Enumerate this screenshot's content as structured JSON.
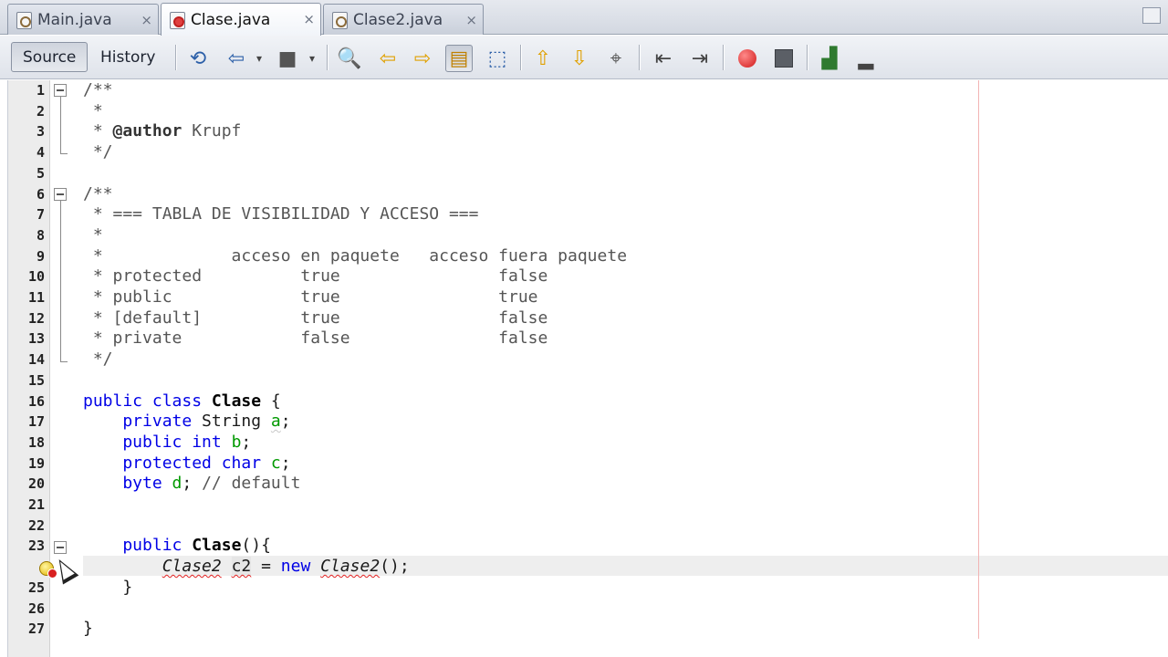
{
  "tabs": [
    {
      "label": "Main.java",
      "active": false,
      "error": false
    },
    {
      "label": "Clase.java",
      "active": true,
      "error": true
    },
    {
      "label": "Clase2.java",
      "active": false,
      "error": false
    }
  ],
  "close_glyph": "×",
  "toolbar": {
    "source_label": "Source",
    "history_label": "History"
  },
  "line_numbers": [
    "1",
    "2",
    "3",
    "4",
    "5",
    "6",
    "7",
    "8",
    "9",
    "10",
    "11",
    "12",
    "13",
    "14",
    "15",
    "16",
    "17",
    "18",
    "19",
    "20",
    "21",
    "22",
    "23",
    "24",
    "25",
    "26",
    "27"
  ],
  "code": {
    "l1": "/**",
    "l2": " *",
    "l3_star": " * ",
    "l3_tag": "@author",
    "l3_rest": " Krupf",
    "l4": " */",
    "l6": "/**",
    "l7": " * === TABLA DE VISIBILIDAD Y ACCESO ===",
    "l8": " *",
    "l9": " *             acceso en paquete   acceso fuera paquete",
    "l10": " * protected          true                false",
    "l11": " * public             true                true",
    "l12": " * [default]          true                false",
    "l13": " * private            false               false",
    "l14": " */",
    "l16_kw": "public class ",
    "l16_name": "Clase",
    "l16_rest": " {",
    "l17_kw": "    private ",
    "l17_type": "String ",
    "l17_var": "a",
    "l17_end": ";",
    "l18_kw": "    public int ",
    "l18_var": "b",
    "l18_end": ";",
    "l19_kw": "    protected char ",
    "l19_var": "c",
    "l19_end": ";",
    "l20_kw": "    byte ",
    "l20_var": "d",
    "l20_end": "; ",
    "l20_cmt": "// default",
    "l23_kw": "    public ",
    "l23_name": "Clase",
    "l23_rest": "(){",
    "l24_indent": "        ",
    "l24_type": "Clase2",
    "l24_sp": " ",
    "l24_var": "c2",
    "l24_eq": " = ",
    "l24_new": "new ",
    "l24_ctor": "Clase2",
    "l24_end": "();",
    "l25": "    }",
    "l27": "}"
  },
  "icons": {
    "hint": "lightbulb-error-icon",
    "cursor": "mouse-pointer-icon"
  },
  "colors": {
    "keyword": "#0000e6",
    "error_underline": "#e02020",
    "margin_line": "#f2b4b4"
  }
}
